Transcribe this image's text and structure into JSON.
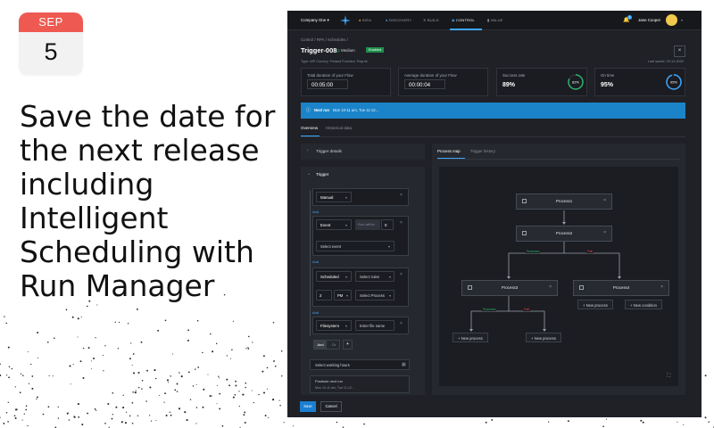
{
  "calendar": {
    "month": "SEP",
    "day": "5"
  },
  "headline": {
    "lines": [
      "Save the date for",
      "the next release",
      "including",
      "Intelligent",
      "Scheduling with",
      "Run Manager"
    ]
  },
  "colors": {
    "accent": "#3ea6ff",
    "calendar_red": "#ee5a52",
    "success": "#2db26b",
    "failure": "#e0453f",
    "info_banner": "#1b84c9"
  },
  "topbar": {
    "company": "Company One",
    "nav": [
      {
        "label": "IDEA",
        "icon": "bulb-icon"
      },
      {
        "label": "DISCOVERY",
        "icon": "compass-icon"
      },
      {
        "label": "BUILD",
        "icon": "tools-icon"
      },
      {
        "label": "CONTROL",
        "icon": "control-icon",
        "active": true
      },
      {
        "label": "VALUE",
        "icon": "chart-icon"
      }
    ],
    "notifications": "1",
    "user": "Jane Cooper"
  },
  "breadcrumb": [
    "Control",
    "RPA",
    "Schedules"
  ],
  "page": {
    "title": "Trigger-008",
    "priority": "Medium",
    "status": "Enabled",
    "meta": "Type: API   Country: Finland   Function: Payroll",
    "last_saved": "Last saved: 29-12-2020"
  },
  "stats": {
    "total_duration": {
      "label": "Total duration of your Flow",
      "value": "00:05:00"
    },
    "avg_duration": {
      "label": "Average duration of your Flow",
      "value": "00:00:04"
    },
    "success_rate": {
      "label": "Success rate",
      "value": "89%",
      "ring": "82%",
      "fraction": 0.82
    },
    "on_time": {
      "label": "On time",
      "value": "95%",
      "ring": "95%",
      "fraction": 0.95
    }
  },
  "next_run": {
    "label": "Next run",
    "text": "Mon 10-11 am, Tue 11-12..."
  },
  "tabs": {
    "overview": "Overview",
    "history": "Historical data"
  },
  "left": {
    "trigger_details": "Trigger details",
    "trigger": "Trigger",
    "manual": "Manual",
    "and": "And",
    "event": "Event",
    "run_within": "Run within",
    "run_within_val": "0",
    "select_event": "Select event",
    "scheduled": "Scheduled",
    "select_rules": "Select rules",
    "hour": "2",
    "ampm": "PM",
    "select_process": "Select Process",
    "filesystem": "Filesystem",
    "file_placeholder": "Enter file name",
    "and_btn": "And",
    "or_btn": "Or",
    "plus": "+",
    "working_hours": "Select working hours",
    "possible_label": "Posibule next run",
    "possible_text": "Mon 10-11 am, Tue 11-12..."
  },
  "right": {
    "tab_map": "Process map",
    "tab_history": "Trigger history",
    "process1": "Process1",
    "process2": "Process2",
    "process3": "Process3",
    "process4": "Process4",
    "success": "Success",
    "fail": "Fail",
    "new_process": "New process",
    "new_condition": "New condition"
  },
  "footer": {
    "save": "Save",
    "cancel": "Cancel"
  }
}
